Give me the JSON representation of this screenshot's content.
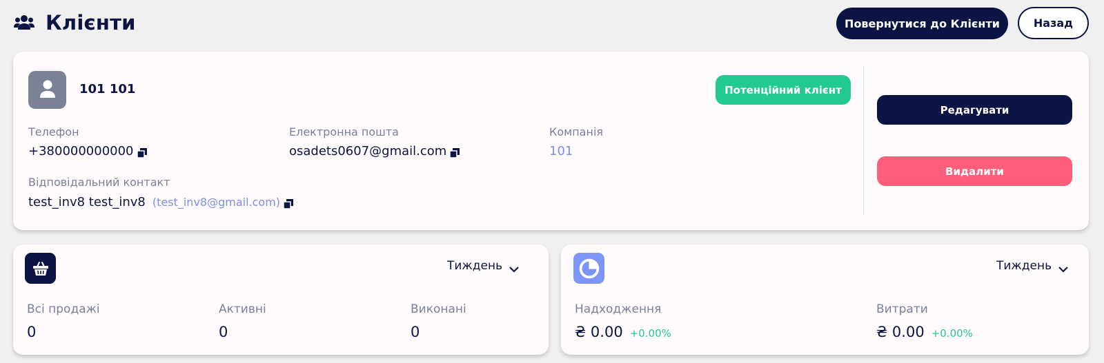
{
  "header": {
    "title": "Клієнти",
    "back_to_list_label": "Повернутися до Клієнти",
    "back_label": "Назад"
  },
  "client": {
    "name": "101 101",
    "status": "Потенційний клієнт",
    "phone_label": "Телефон",
    "phone": "+380000000000",
    "email_label": "Електронна пошта",
    "email": "osadets0607@gmail.com",
    "company_label": "Компанія",
    "company": "101",
    "responsible_label": "Відповідальний контакт",
    "responsible_name": "test_inv8 test_inv8",
    "responsible_email": "(test_inv8@gmail.com)"
  },
  "actions": {
    "edit_label": "Редагувати",
    "delete_label": "Видалити"
  },
  "sales": {
    "period": "Тиждень",
    "all_label": "Всі продажі",
    "all_value": "0",
    "active_label": "Активні",
    "active_value": "0",
    "done_label": "Виконані",
    "done_value": "0"
  },
  "finance": {
    "period": "Тиждень",
    "income_label": "Надходження",
    "income_value": "₴ 0.00",
    "income_delta": "+0.00%",
    "expense_label": "Витрати",
    "expense_value": "₴ 0.00",
    "expense_delta": "+0.00%"
  },
  "colors": {
    "primary": "#0b1442",
    "success": "#22c993",
    "danger": "#ff5e7a",
    "accent": "#7c8fe6",
    "avatar_bg": "#7c8295"
  },
  "icons": {
    "title": "users-icon",
    "avatar": "user-icon",
    "copy": "copy-icon",
    "sales": "basket-icon",
    "finance": "pie-chart-icon",
    "dropdown": "chevron-down-icon"
  }
}
